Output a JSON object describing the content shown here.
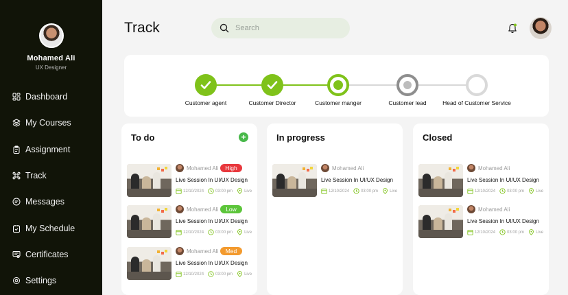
{
  "user": {
    "name": "Mohamed Ali",
    "role": "UX Designer"
  },
  "nav": [
    {
      "label": "Dashboard",
      "icon": "dashboard-icon"
    },
    {
      "label": "My Courses",
      "icon": "layers-icon"
    },
    {
      "label": "Assignment",
      "icon": "clipboard-icon"
    },
    {
      "label": "Track",
      "icon": "command-icon"
    },
    {
      "label": "Messages",
      "icon": "message-icon"
    },
    {
      "label": "My Schedule",
      "icon": "calendar-check-icon"
    },
    {
      "label": "Certificates",
      "icon": "certificate-icon"
    },
    {
      "label": "Settings",
      "icon": "gear-icon"
    }
  ],
  "header": {
    "title": "Track",
    "search_placeholder": "Search"
  },
  "tracker": {
    "steps": [
      {
        "label": "Customer agent",
        "status": "done"
      },
      {
        "label": "Customer Director",
        "status": "done"
      },
      {
        "label": "Customer manger",
        "status": "current"
      },
      {
        "label": "Customer lead",
        "status": "next"
      },
      {
        "label": "Head of Customer Service",
        "status": "pending"
      }
    ]
  },
  "columns": [
    {
      "title": "To do",
      "add": "+",
      "cards": [
        {
          "author": "Mohamed Ali",
          "badge": "High",
          "badge_color": "#e8383d",
          "title": "Live Session In UI/UX Design",
          "date": "12/10/2024",
          "time": "03:00 pm",
          "mode": "Live"
        },
        {
          "author": "Mohamed Ali",
          "badge": "Low",
          "badge_color": "#5cc53a",
          "title": "Live Session In UI/UX Design",
          "date": "12/10/2024",
          "time": "03:00 pm",
          "mode": "Live"
        },
        {
          "author": "Mohamed Ali",
          "badge": "Med",
          "badge_color": "#f39a2e",
          "title": "Live Session In UI/UX Design",
          "date": "12/10/2024",
          "time": "03:00 pm",
          "mode": "Live"
        }
      ]
    },
    {
      "title": "In progress",
      "cards": [
        {
          "author": "Mohamed Ali",
          "title": "Live Session In UI/UX Design",
          "date": "12/10/2024",
          "time": "03:00 pm",
          "mode": "Live"
        }
      ]
    },
    {
      "title": "Closed",
      "cards": [
        {
          "author": "Mohamed Ali",
          "title": "Live Session In UI/UX Design",
          "date": "12/10/2024",
          "time": "03:00 pm",
          "mode": "Live"
        },
        {
          "author": "Mohamed Ali",
          "title": "Live Session In UI/UX Design",
          "date": "12/10/2024",
          "time": "03:00 pm",
          "mode": "Live"
        }
      ]
    }
  ],
  "colors": {
    "sidebar": "#111408",
    "accent": "#7fc21a",
    "search_bg": "#e7eee2"
  }
}
